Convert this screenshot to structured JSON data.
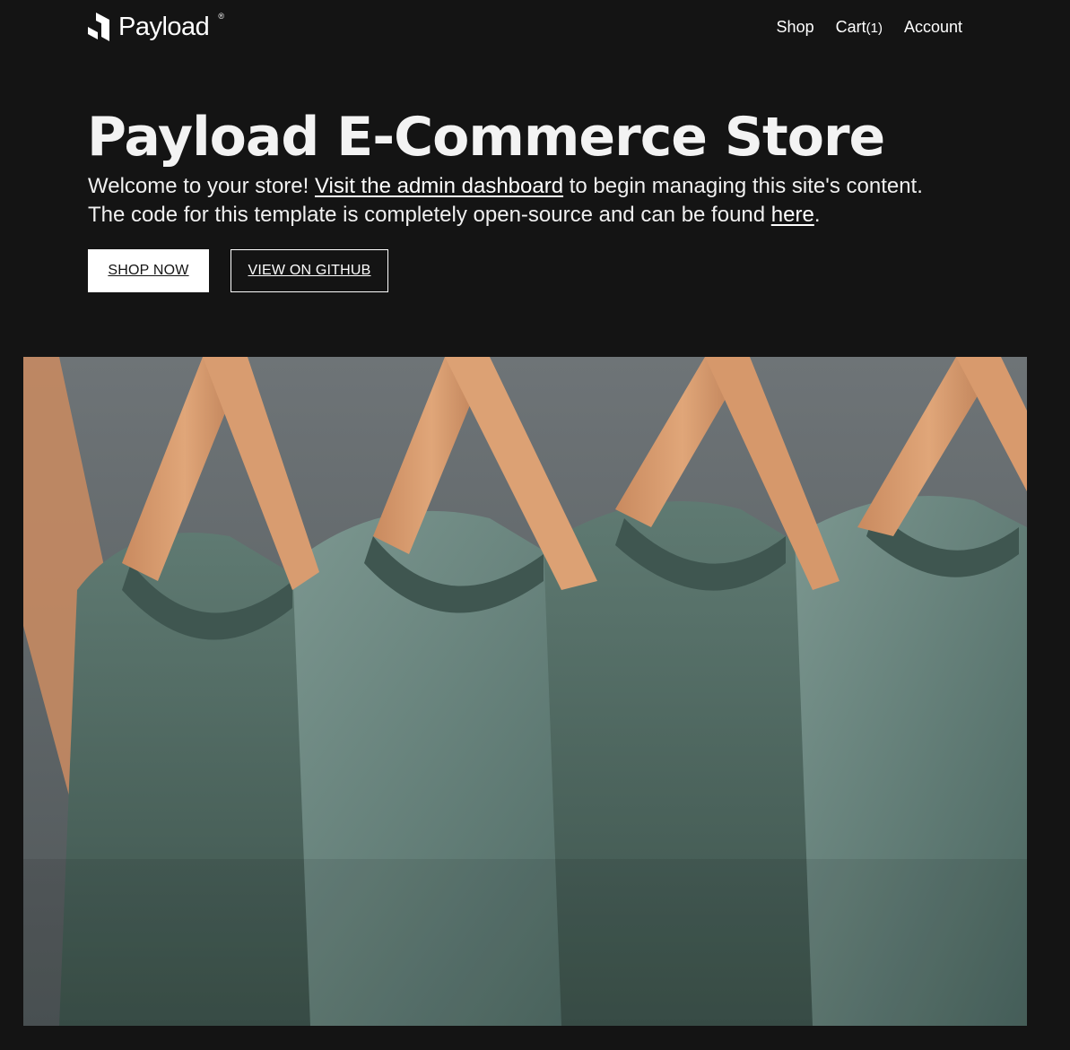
{
  "header": {
    "logo_text": "Payload",
    "logo_registered": "®",
    "nav": {
      "shop": "Shop",
      "cart": "Cart",
      "cart_count": "(1)",
      "account": "Account"
    }
  },
  "hero": {
    "title": "Payload E-Commerce Store",
    "text_part1": "Welcome to your store! ",
    "admin_link": "Visit the admin dashboard",
    "text_part2": " to begin managing this site's content. The code for this template is completely open-source and can be found ",
    "here_link": "here",
    "text_part3": ".",
    "buttons": {
      "shop_now": "Shop Now",
      "view_github": "View on GitHub"
    }
  },
  "media": {
    "hero_image": "t-shirts-on-wooden-hangers"
  },
  "colors": {
    "background": "#141414",
    "text": "#ffffff",
    "primary_button_bg": "#ffffff",
    "primary_button_text": "#141414"
  }
}
